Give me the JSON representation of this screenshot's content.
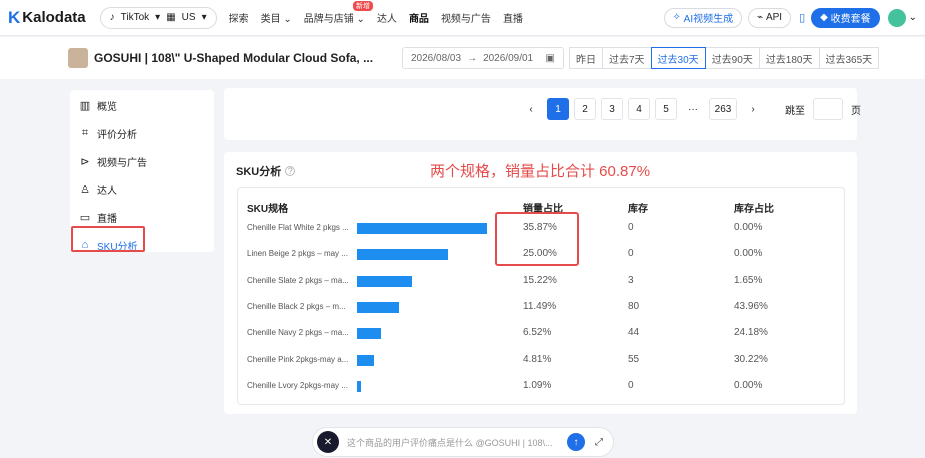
{
  "nav": {
    "logo": "Kalodata",
    "platform": "TikTok",
    "region": "US",
    "items": [
      "探索",
      "类目",
      "品牌与店铺",
      "达人",
      "商品",
      "视频与广告",
      "直播"
    ],
    "new_badge": "新增",
    "ai_button": "AI视频生成",
    "api_button": "API",
    "pay_button": "收费套餐"
  },
  "product": {
    "title": "GOSUHI | 108\\\" U-Shaped Modular Cloud Sofa, ...",
    "date_start": "2026/08/03",
    "date_end": "2026/09/01",
    "quick_ranges": [
      "昨日",
      "过去7天",
      "过去30天",
      "过去90天",
      "过去180天",
      "过去365天"
    ],
    "active_range": "过去30天"
  },
  "sidebar": {
    "items": [
      {
        "label": "概览",
        "icon": "chart-icon"
      },
      {
        "label": "评价分析",
        "icon": "review-icon"
      },
      {
        "label": "视频与广告",
        "icon": "play-icon"
      },
      {
        "label": "达人",
        "icon": "user-icon"
      },
      {
        "label": "直播",
        "icon": "video-camera-icon"
      },
      {
        "label": "SKU分析",
        "icon": "tag-icon"
      }
    ],
    "active": "SKU分析"
  },
  "pagination": {
    "pages": [
      "1",
      "2",
      "3",
      "4",
      "5",
      "···",
      "263"
    ],
    "current": "1",
    "jump_label": "跳至",
    "page_suffix": "页"
  },
  "sku": {
    "title": "SKU分析",
    "annotation": "两个规格，销量占比合计 60.87%",
    "headers": [
      "SKU规格",
      "销量占比",
      "库存",
      "库存占比"
    ],
    "rows": [
      {
        "name": "Chenille Flat White 2 pkgs ...",
        "share": "35.87%",
        "value": 35.87,
        "stock": "0",
        "stock_share": "0.00%"
      },
      {
        "name": "Linen Beige 2 pkgs – may ...",
        "share": "25.00%",
        "value": 25.0,
        "stock": "0",
        "stock_share": "0.00%"
      },
      {
        "name": "Chenille Slate 2 pkgs – ma...",
        "share": "15.22%",
        "value": 15.22,
        "stock": "3",
        "stock_share": "1.65%"
      },
      {
        "name": "Chenille Black 2 pkgs – m...",
        "share": "11.49%",
        "value": 11.49,
        "stock": "80",
        "stock_share": "43.96%"
      },
      {
        "name": "Chenille Navy 2 pkgs – ma...",
        "share": "6.52%",
        "value": 6.52,
        "stock": "44",
        "stock_share": "24.18%"
      },
      {
        "name": "Chenille Pink 2pkgs-may a...",
        "share": "4.81%",
        "value": 4.81,
        "stock": "55",
        "stock_share": "30.22%"
      },
      {
        "name": "Chenille Lvory 2pkgs-may ...",
        "share": "1.09%",
        "value": 1.09,
        "stock": "0",
        "stock_share": "0.00%"
      }
    ],
    "bar_color": "#1e8df0"
  },
  "ask": {
    "placeholder": "这个商品的用户评价痛点是什么 @GOSUHI | 108\\..."
  },
  "colors": {
    "accent": "#1f6fe8",
    "highlight": "#e64b4b"
  }
}
